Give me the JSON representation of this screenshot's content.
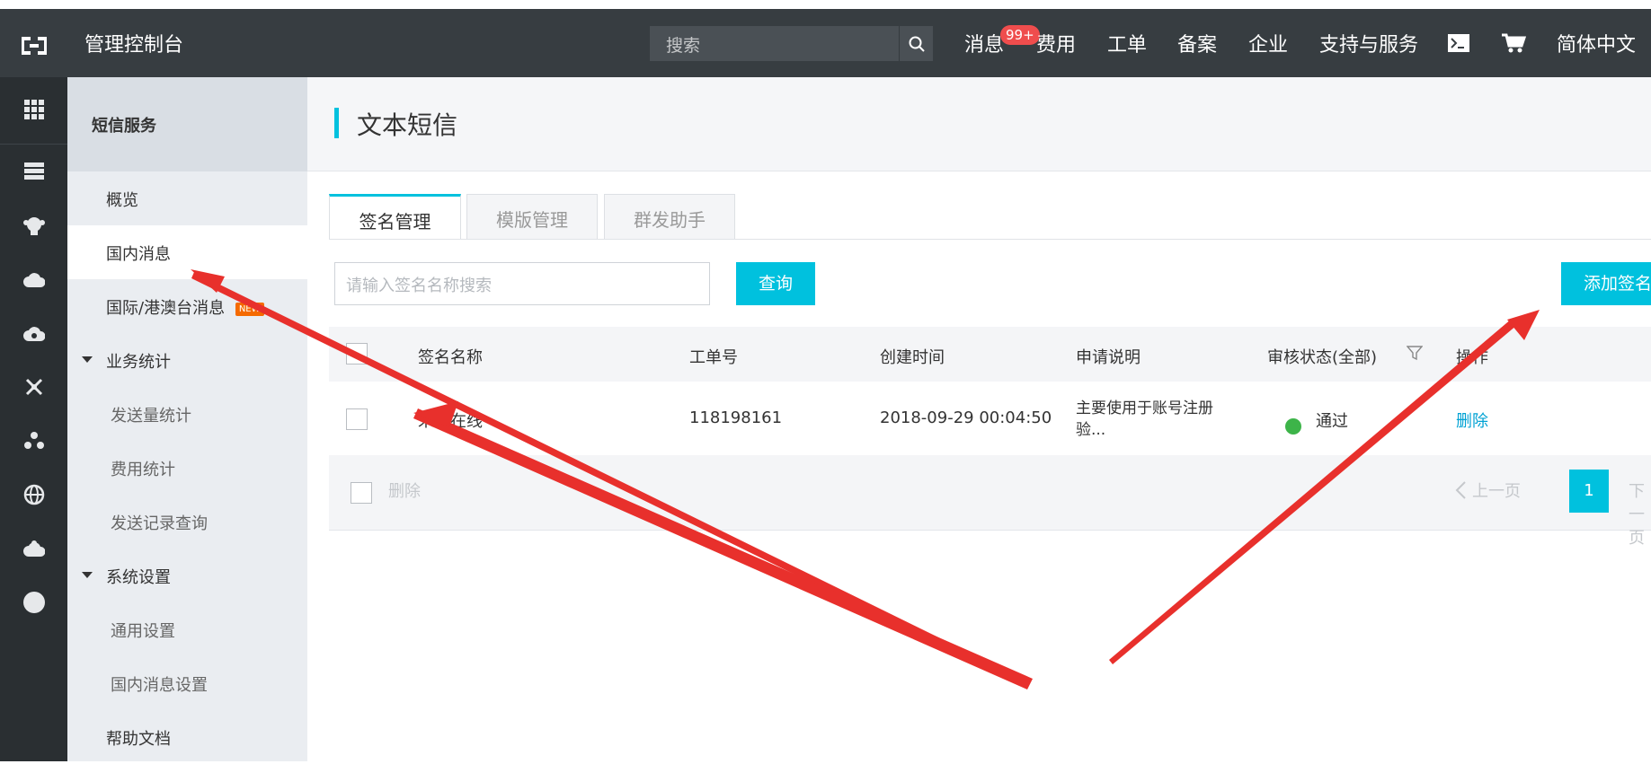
{
  "topbar": {
    "app_title": "管理控制台",
    "search_placeholder": "搜索",
    "nav": {
      "messages": "消息",
      "messages_badge": "99+",
      "billing": "费用",
      "tickets": "工单",
      "icp": "备案",
      "enterprise": "企业",
      "support": "支持与服务",
      "language": "简体中文"
    },
    "icons": [
      "logo-icon",
      "search-icon",
      "terminal-icon",
      "cart-icon"
    ]
  },
  "left_rail": {
    "icons": [
      "grid-icon",
      "server-icon",
      "monkey-icon",
      "cloud-icon",
      "cloud-gear-icon",
      "cross-icon",
      "nodes-icon",
      "globe-icon",
      "gear-cloud-icon",
      "circle-icon"
    ]
  },
  "sidebar": {
    "header": "短信服务",
    "items": [
      {
        "label": "概览"
      },
      {
        "label": "国内消息"
      },
      {
        "label": "国际/港澳台消息",
        "tag": "NEW"
      },
      {
        "label": "业务统计"
      },
      {
        "label": "发送量统计"
      },
      {
        "label": "费用统计"
      },
      {
        "label": "发送记录查询"
      },
      {
        "label": "系统设置"
      },
      {
        "label": "通用设置"
      },
      {
        "label": "国内消息设置"
      },
      {
        "label": "帮助文档"
      }
    ]
  },
  "main": {
    "title": "文本短信",
    "tabs": [
      {
        "label": "签名管理"
      },
      {
        "label": "模版管理"
      },
      {
        "label": "群发助手"
      }
    ],
    "query_placeholder": "请输入签名名称搜索",
    "query_button": "查询",
    "add_button": "添加签名",
    "table": {
      "headers": [
        "签名名称",
        "工单号",
        "创建时间",
        "申请说明",
        "审核状态(全部)",
        "操作"
      ],
      "rows": [
        {
          "name": "未来在线",
          "ticket": "118198161",
          "created": "2018-09-29 00:04:50",
          "note_line1": "主要使用于账号注册",
          "note_line2": "验...",
          "status": "通过",
          "action": "删除"
        }
      ]
    },
    "footer": {
      "delete": "删除",
      "prev": "上一页",
      "page": "1",
      "next": "下一页"
    }
  },
  "colors": {
    "accent": "#00c1de",
    "topbar": "#373d41",
    "annotation": "#e8302c",
    "status_ok": "#3db449"
  }
}
